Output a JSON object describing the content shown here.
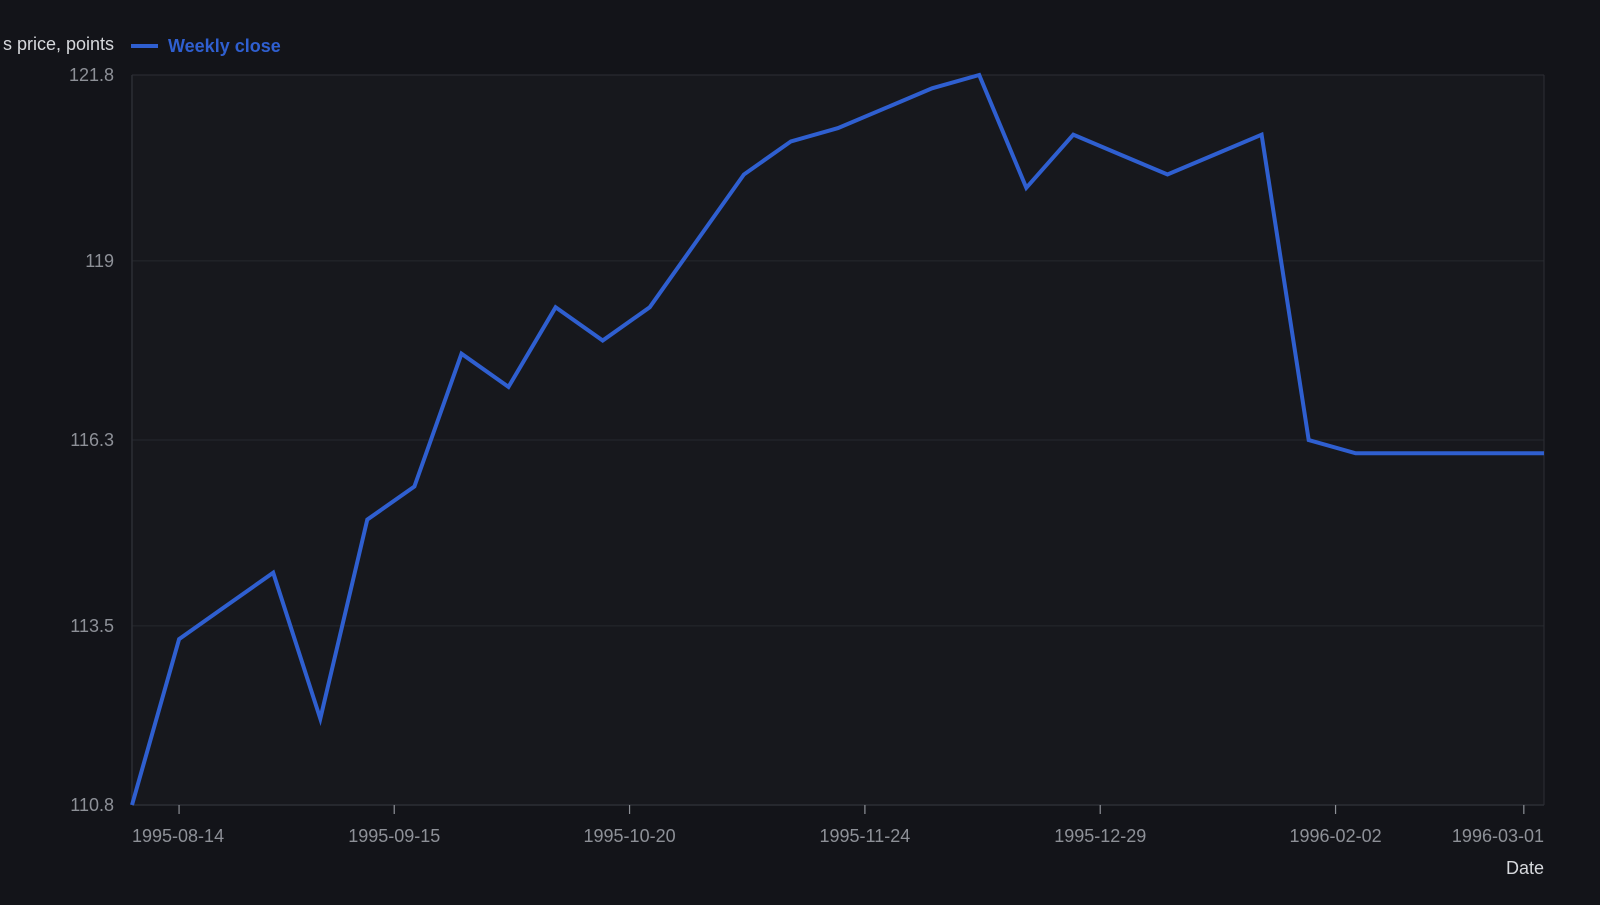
{
  "colors": {
    "background": "#131419",
    "plot_background": "#17181d",
    "series": "#2f5fd0",
    "grid": "#26282e",
    "frame": "#2c2e35",
    "tick_text": "#8d9097",
    "label_text": "#d6d8dc"
  },
  "chart_data": {
    "type": "line",
    "title": "",
    "ylabel": "s price, points",
    "xlabel": "Date",
    "x_axis_type": "date",
    "ylim": [
      110.8,
      121.8
    ],
    "yticks": [
      110.8,
      113.5,
      116.3,
      119,
      121.8
    ],
    "xticks": [
      "1995-08-14",
      "1995-09-15",
      "1995-10-20",
      "1995-11-24",
      "1995-12-29",
      "1996-02-02",
      "1996-03-01"
    ],
    "grid": true,
    "legend": "top-left",
    "series": [
      {
        "name": "Weekly close",
        "x": [
          "1995-08-07",
          "1995-08-14",
          "1995-08-21",
          "1995-08-28",
          "1995-09-04",
          "1995-09-11",
          "1995-09-18",
          "1995-09-25",
          "1995-10-02",
          "1995-10-09",
          "1995-10-16",
          "1995-10-23",
          "1995-10-30",
          "1995-11-06",
          "1995-11-13",
          "1995-11-20",
          "1995-11-27",
          "1995-12-04",
          "1995-12-11",
          "1995-12-18",
          "1995-12-25",
          "1996-01-01",
          "1996-01-08",
          "1996-01-15",
          "1996-01-22",
          "1996-01-29",
          "1996-02-05",
          "1996-02-12",
          "1996-02-19",
          "1996-02-26",
          "1996-03-04"
        ],
        "y": [
          110.8,
          113.3,
          113.8,
          114.3,
          112.1,
          115.1,
          115.6,
          117.6,
          117.1,
          118.3,
          117.8,
          118.3,
          119.3,
          120.3,
          120.8,
          121.0,
          121.3,
          121.6,
          121.8,
          120.1,
          120.9,
          120.6,
          120.3,
          120.6,
          120.9,
          116.3,
          116.1,
          116.1,
          116.1,
          116.1,
          116.1
        ],
        "color": "#2f5fd0"
      }
    ]
  }
}
